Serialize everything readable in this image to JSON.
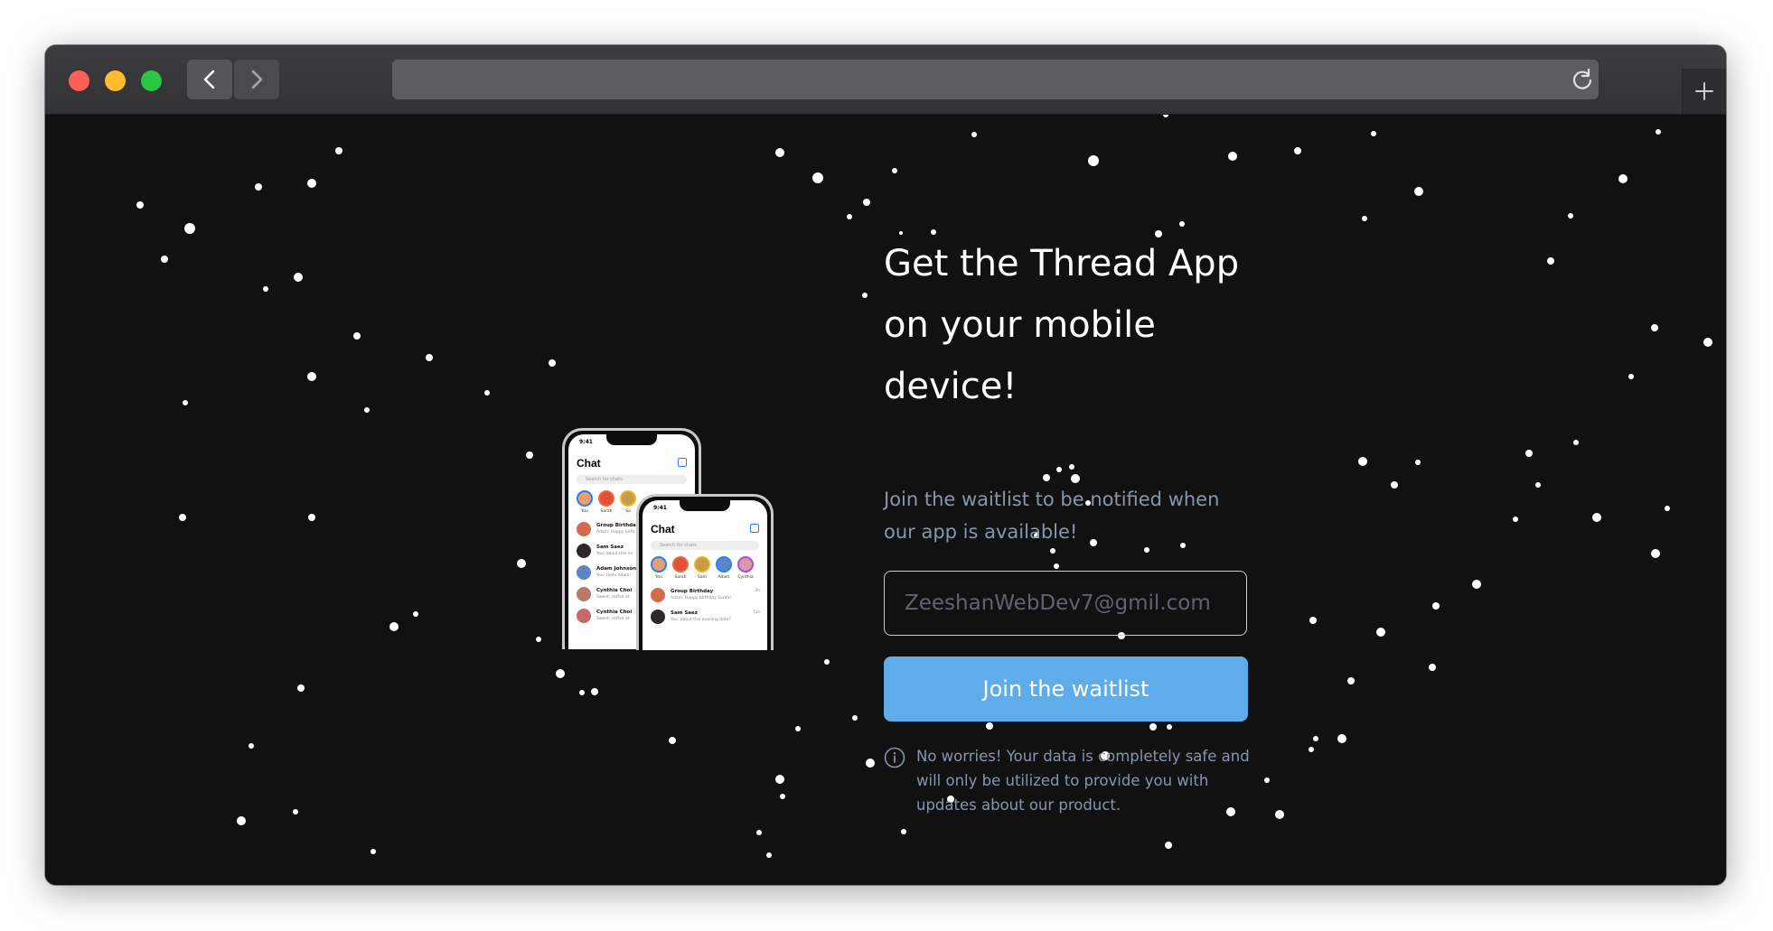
{
  "browser": {
    "window_controls": [
      "close",
      "minimize",
      "maximize"
    ],
    "nav": {
      "back_icon": "chevron-left-icon",
      "forward_icon": "chevron-right-icon"
    },
    "address": "",
    "reload_icon": "reload-icon",
    "new_tab_icon": "plus-icon"
  },
  "hero": {
    "heading": "Get the Thread App on your mobile device!",
    "subtext": "Join the waitlist to be notified when our app is available!",
    "email_placeholder": "ZeeshanWebDev7@gmil.com",
    "join_button": "Join the waitlist",
    "info_icon": "info-circle-icon",
    "disclaimer": "No worries! Your data is completely safe and will only be utilized to provide you with updates about our product."
  },
  "phone_mockup": {
    "time": "9:41",
    "title": "Chat",
    "search_placeholder": "Search for chats",
    "back_stories": [
      "You",
      "Sarah",
      "Sa"
    ],
    "front_stories": [
      "You",
      "Sarah",
      "Sam",
      "Adam",
      "Cynthia"
    ],
    "back_chats": [
      {
        "name": "Group Birthday",
        "message": "Adam: Happy birth"
      },
      {
        "name": "Sam Saez",
        "message": "You: about this ev"
      },
      {
        "name": "Adam Johnson",
        "message": "You: Hello Adam!"
      },
      {
        "name": "Cynthia Choi",
        "message": "Sweet, coffee at"
      },
      {
        "name": "Cynthia Choi",
        "message": "Sweet, coffee at"
      }
    ],
    "front_chats": [
      {
        "name": "Group Birthday",
        "message": "Adam: Happy birthday Sarah!",
        "time": "3h"
      },
      {
        "name": "Sam Saez",
        "message": "You: about this evening date?",
        "time": "Tue"
      }
    ]
  },
  "colors": {
    "background": "#111112",
    "accent_button": "#5eadea",
    "muted_text": "#8796ad",
    "heading_text": "#ffffff",
    "stars": "#ffffff"
  }
}
